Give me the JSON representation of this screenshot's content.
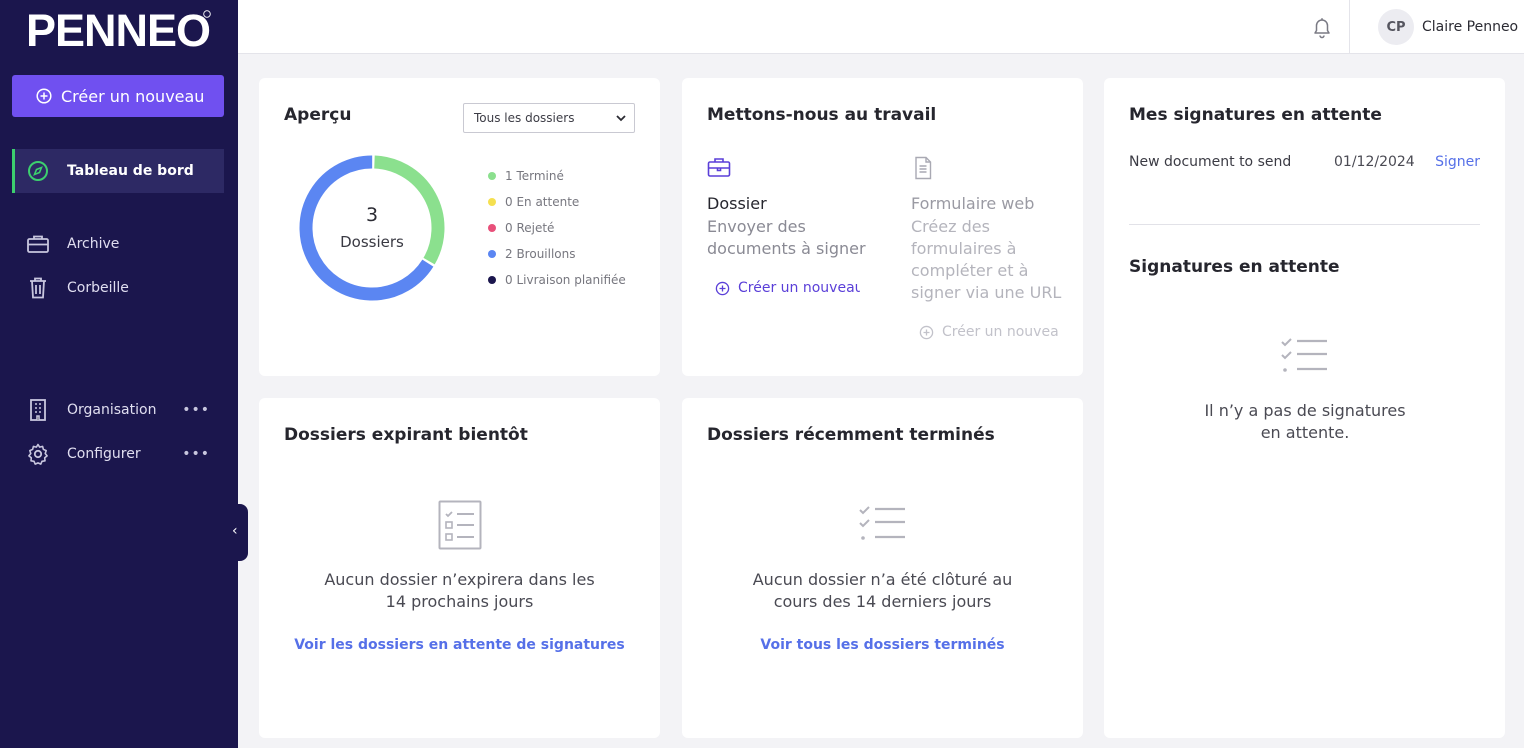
{
  "brand": {
    "logo_text": "PENNEO"
  },
  "sidebar": {
    "create_label": "Créer un nouveau",
    "items": [
      {
        "label": "Tableau de bord",
        "icon": "compass-icon",
        "active": true
      },
      {
        "label": "Archive",
        "icon": "briefcase-icon"
      },
      {
        "label": "Corbeille",
        "icon": "trash-icon"
      },
      {
        "label": "Organisation",
        "icon": "building-icon",
        "more": "•••"
      },
      {
        "label": "Configurer",
        "icon": "gear-icon",
        "more": "•••"
      }
    ],
    "collapse_icon": "chevron-left-icon"
  },
  "header": {
    "notification_icon": "bell-icon",
    "user": {
      "initials": "CP",
      "name": "Claire Penneo"
    }
  },
  "overview": {
    "title": "Aperçu",
    "filter_value": "Tous les dossiers",
    "total": "3",
    "total_label": "Dossiers",
    "legend": [
      {
        "label": "1 Terminé",
        "count": 1,
        "color": "#8be08e"
      },
      {
        "label": "0 En attente",
        "count": 0,
        "color": "#f5e050"
      },
      {
        "label": "0 Rejeté",
        "count": 0,
        "color": "#e8507a"
      },
      {
        "label": "2 Brouillons",
        "count": 2,
        "color": "#5b86f2"
      },
      {
        "label": "0 Livraison planifiée",
        "count": 0,
        "color": "#1b164d"
      }
    ]
  },
  "get_to_work": {
    "title": "Mettons-nous au travail",
    "dossier": {
      "icon": "briefcase-icon",
      "title": "Dossier",
      "desc": "Envoyer des documents à signer",
      "link": "Créer un nouveau"
    },
    "webform": {
      "icon": "document-icon",
      "title": "Formulaire web",
      "desc": "Créez des formulaires à compléter et à signer via une URL",
      "link": "Créer un nouveau"
    }
  },
  "my_signatures": {
    "title": "Mes signatures en attente",
    "rows": [
      {
        "document": "New document to send",
        "date": "01/12/2024",
        "action": "Signer"
      }
    ],
    "pending_title": "Signatures en attente",
    "empty_icon": "checklist-icon",
    "empty_text": "Il n’y a pas de signatures en attente."
  },
  "expiring": {
    "title": "Dossiers expirant bientôt",
    "empty_icon": "checklist-box-icon",
    "empty_text": "Aucun dossier n’expirera dans les 14 prochains jours",
    "link": "Voir les dossiers en attente de signatures"
  },
  "completed": {
    "title": "Dossiers récemment terminés",
    "empty_icon": "checklist-icon",
    "empty_text": "Aucun dossier n’a été clôturé au cours des 14 derniers jours",
    "link": "Voir tous les dossiers terminés"
  }
}
